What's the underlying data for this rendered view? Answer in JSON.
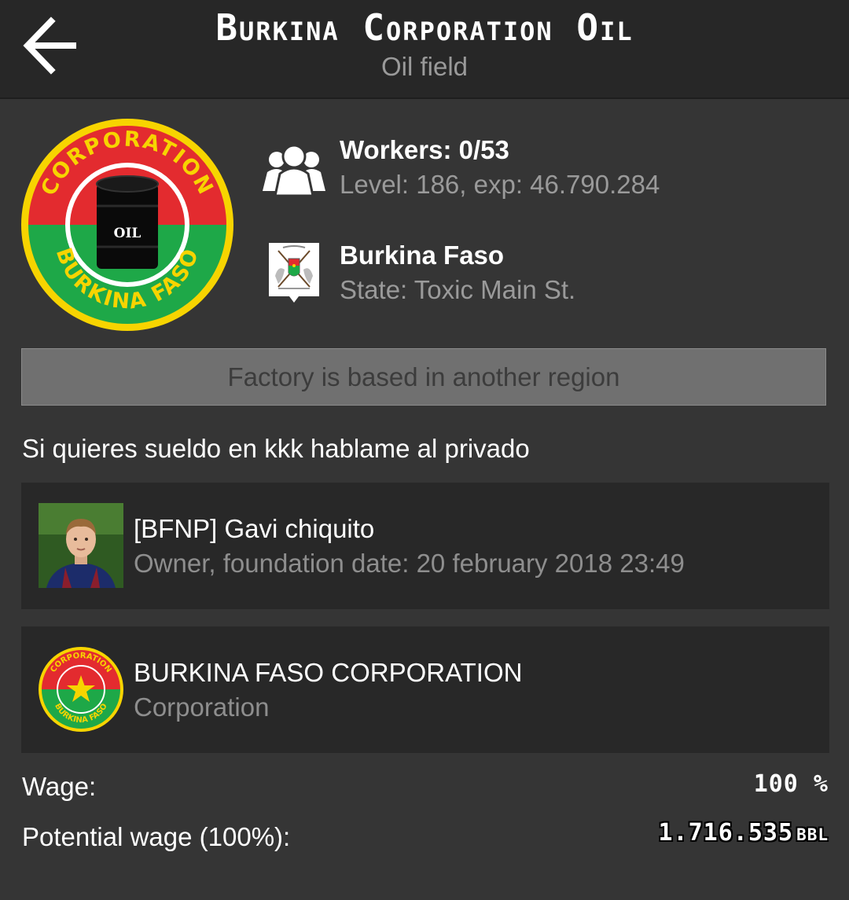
{
  "header": {
    "title": "Burkina Corporation Oil",
    "subtitle": "Oil field"
  },
  "logo": {
    "ring_top_text": "CORPORATION",
    "ring_bottom_text": "BURKINA FASO",
    "barrel_label": "OIL",
    "colors": {
      "red": "#e32b2f",
      "green": "#1ea848",
      "yellow": "#f7d400"
    }
  },
  "workers": {
    "icon": "workers-icon",
    "label": "Workers: 0/53",
    "sub": "Level: 186, exp: 46.790.284"
  },
  "region": {
    "icon": "coat-of-arms-icon",
    "label": "Burkina Faso",
    "sub": "State: Toxic Main St."
  },
  "region_button": {
    "label": "Factory is based in another region"
  },
  "description": "Si quieres sueldo en kkk hablame al privado",
  "owner": {
    "name": "[BFNP] Gavi chiquito",
    "sub": "Owner, foundation date: 20 february 2018 23:49"
  },
  "corporation": {
    "name": "BURKINA FASO CORPORATION",
    "sub": "Corporation",
    "logo_top_text": "CORPORATION",
    "logo_bottom_text": "BURKINA FASO"
  },
  "wage": {
    "label": "Wage:",
    "value": "100 %"
  },
  "potential_wage": {
    "label": "Potential wage (100%):",
    "value": "1.716.535",
    "unit": "BBL"
  },
  "colors": {
    "background": "#353535",
    "header": "#272727",
    "card": "#282828",
    "muted_text": "#9a9a9a"
  }
}
